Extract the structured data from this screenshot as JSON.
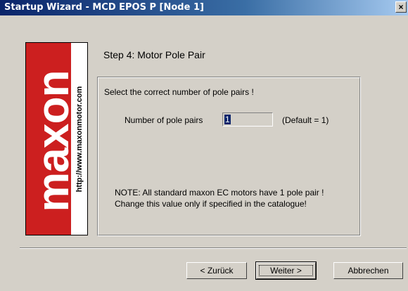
{
  "window": {
    "title": "Startup Wizard - MCD EPOS P [Node 1]",
    "close_glyph": "×"
  },
  "logo": {
    "brand": "maxon",
    "url": "http://www.maxonmotor.com",
    "brand_color": "#cc1f1f"
  },
  "wizard": {
    "step_title": "Step 4: Motor Pole Pair",
    "instruction": "Select the correct number of pole pairs !",
    "pole_pairs_label": "Number of pole pairs",
    "pole_pairs_value": "1",
    "default_hint": "(Default = 1)",
    "note_line1": "NOTE: All standard maxon EC motors have 1 pole pair !",
    "note_line2": "Change this value only if specified in the catalogue!"
  },
  "buttons": {
    "back": "< Zurück",
    "next": "Weiter >",
    "cancel": "Abbrechen"
  },
  "colors": {
    "title_bar": "#0a246a",
    "face": "#d4d0c8",
    "selection": "#0a246a"
  },
  "icons": {
    "close": "close-icon"
  }
}
